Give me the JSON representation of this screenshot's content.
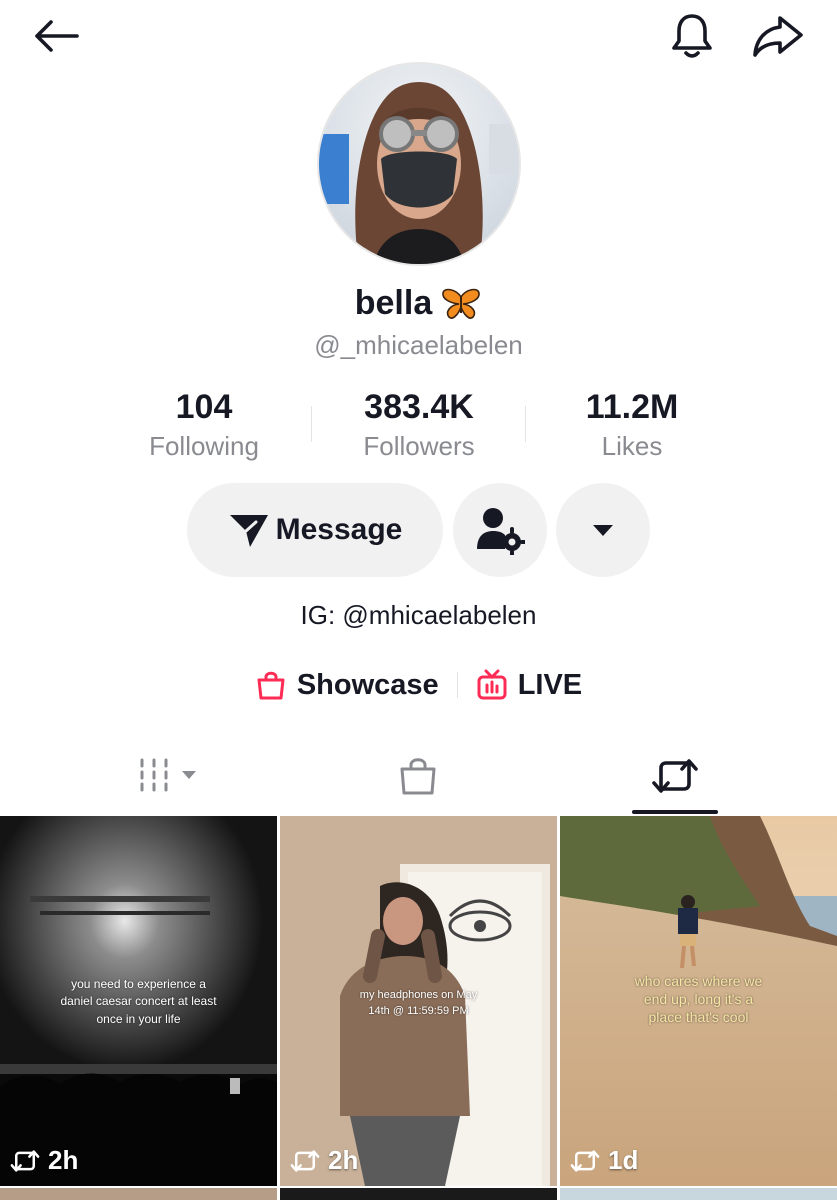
{
  "profile": {
    "name": "bella",
    "handle": "@_mhicaelabelen",
    "bio": "IG: @mhicaelabelen"
  },
  "stats": [
    {
      "value": "104",
      "label": "Following"
    },
    {
      "value": "383.4K",
      "label": "Followers"
    },
    {
      "value": "11.2M",
      "label": "Likes"
    }
  ],
  "actions": {
    "message_label": "Message"
  },
  "links": {
    "showcase_label": "Showcase",
    "live_label": "LIVE"
  },
  "tabs": {
    "active": "reposts"
  },
  "videos": [
    {
      "caption": "you need to experience a daniel caesar concert at least once in your life",
      "time": "2h"
    },
    {
      "caption": "my headphones on May 14th @ 11:59:59 PM",
      "time": "2h"
    },
    {
      "caption": "who cares where we end up, long it's a place that's cool",
      "time": "1d"
    }
  ],
  "colors": {
    "accent": "#fe2c55",
    "text": "#161823",
    "muted": "#8a8b91",
    "button_bg": "#f1f1f2"
  },
  "icons": {
    "back": "arrow-left-icon",
    "bell": "bell-icon",
    "share": "share-arrow-icon",
    "message": "paper-plane-icon",
    "user_settings": "user-gear-icon",
    "more": "caret-down-icon",
    "showcase": "shopping-bag-icon",
    "live": "tv-icon",
    "repost": "repost-icon"
  }
}
